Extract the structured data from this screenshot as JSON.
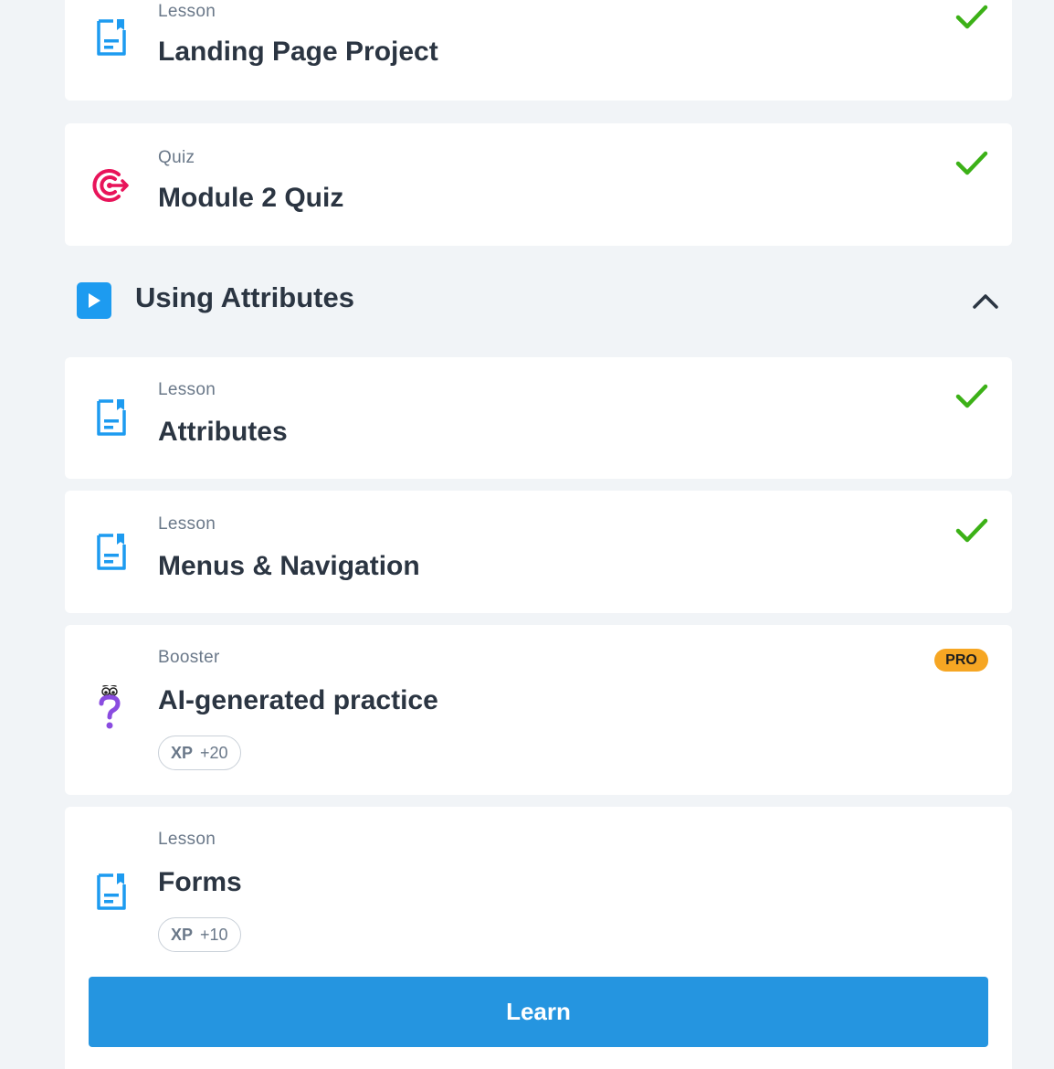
{
  "items": [
    {
      "type": "Lesson",
      "title": "Landing Page Project",
      "icon": "lesson-doc-icon",
      "completed": true
    },
    {
      "type": "Quiz",
      "title": "Module 2 Quiz",
      "icon": "target-icon",
      "completed": true
    }
  ],
  "section": {
    "title": "Using Attributes",
    "icon": "play-icon",
    "expanded": true
  },
  "section_items": [
    {
      "type": "Lesson",
      "title": "Attributes",
      "icon": "lesson-doc-icon",
      "completed": true
    },
    {
      "type": "Lesson",
      "title": "Menus & Navigation",
      "icon": "lesson-doc-icon",
      "completed": true
    },
    {
      "type": "Booster",
      "title": "AI-generated practice",
      "icon": "question-icon",
      "badge": "PRO",
      "xp_label": "XP",
      "xp_value": "+20"
    },
    {
      "type": "Lesson",
      "title": "Forms",
      "icon": "lesson-doc-icon",
      "xp_label": "XP",
      "xp_value": "+10",
      "button": "Learn"
    }
  ],
  "colors": {
    "background": "#f1f4f7",
    "accent": "#2595e0",
    "check": "#3cb117",
    "pro": "#f6a623",
    "quiz_icon": "#e8145a",
    "booster_icon": "#8a4ce0"
  }
}
